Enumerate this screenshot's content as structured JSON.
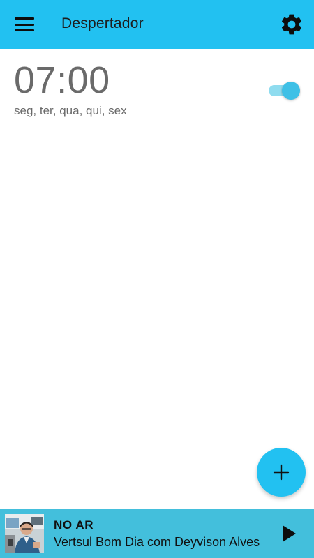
{
  "appbar": {
    "title": "Despertador",
    "menu_icon": "menu-icon",
    "settings_icon": "gear-icon",
    "background_color": "#22c1f1"
  },
  "alarms": [
    {
      "time": "07:00",
      "days": "seg, ter, qua, qui, sex",
      "enabled": true
    }
  ],
  "fab": {
    "icon": "plus-icon",
    "color": "#22c1f1"
  },
  "player": {
    "status": "NO AR",
    "show": "Vertsul Bom Dia com Deyvison Alves",
    "play_icon": "play-icon",
    "background_color": "#43bfdc"
  }
}
